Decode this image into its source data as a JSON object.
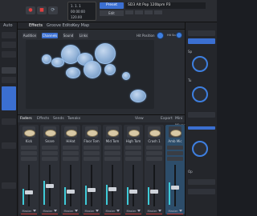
{
  "transport": {
    "record_icon": "record-icon",
    "stop_icon": "stop-icon",
    "loop_icon": "loop-icon",
    "position_lines": [
      "1. 1. 1",
      "00:00:00",
      "120.00"
    ],
    "preset_label": "Preset",
    "second_button": "Edit",
    "info_text": "SD3 Alt Pop 120bpm P3"
  },
  "tabs": {
    "auto_label": "Auto",
    "items": [
      "Effects",
      "Groove Editor",
      "Key Map"
    ]
  },
  "kit_toolbar": {
    "pills": [
      "Audition",
      "Channels",
      "Sound",
      "Links"
    ],
    "active_pill": "Channels",
    "hit_position_label": "Hit Position",
    "hit_scaling_label": "Hit Scaling"
  },
  "mixer": {
    "tabs": [
      "Faders",
      "Effects",
      "Sends",
      "Tweaks"
    ],
    "view_label": "View",
    "export_label": "Export",
    "mini_mixer_label": "Mini Mixer",
    "channels": [
      {
        "name": "Kick",
        "level": 0.34,
        "out": "Master"
      },
      {
        "name": "Snare",
        "level": 0.5,
        "out": "Master"
      },
      {
        "name": "HiHat",
        "level": 0.36,
        "out": "Master"
      },
      {
        "name": "Floor Tom",
        "level": 0.4,
        "out": "Master"
      },
      {
        "name": "Mid Tom",
        "level": 0.42,
        "out": "Master"
      },
      {
        "name": "High Tom",
        "level": 0.36,
        "out": "Master"
      },
      {
        "name": "Crash 1",
        "level": 0.36,
        "out": "Master"
      },
      {
        "name": "Amb Mic",
        "level": 0.46,
        "out": "Master"
      }
    ]
  },
  "right_panel": {
    "label_a": "Sp",
    "label_b": "Tu",
    "label_c": "Op"
  },
  "colors": {
    "accent": "#3b6fd1",
    "drum_blue": "#8fb0d6",
    "record_red": "#e04040"
  }
}
